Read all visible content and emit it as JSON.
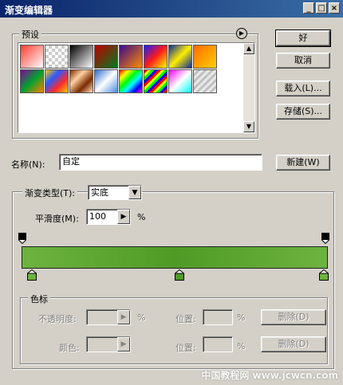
{
  "window": {
    "title": "渐变编辑器"
  },
  "titlebar_buttons": {
    "minimize": "_",
    "maximize": "□",
    "close": "×"
  },
  "presets": {
    "label": "预设",
    "menu_icon": "circle-arrow-icon"
  },
  "buttons": {
    "ok": "好",
    "cancel": "取消",
    "load": "载入(L)...",
    "save": "存储(S)...",
    "new": "新建(W)"
  },
  "name": {
    "label": "名称(N):",
    "value": "自定"
  },
  "gradient": {
    "type_label": "渐变类型(T):",
    "type_value": "实底",
    "smoothness_label": "平滑度(M):",
    "smoothness_value": "100",
    "smoothness_unit": "%",
    "colors": {
      "start": "#6db33f",
      "mid": "#4f9a26",
      "end": "#6db33f"
    }
  },
  "stops": {
    "group_label": "色标",
    "opacity_label": "不透明度:",
    "opacity_unit": "%",
    "opacity_location_label": "位置:",
    "opacity_location_unit": "%",
    "opacity_delete": "删除(D)",
    "color_label": "颜色:",
    "color_location_label": "位置:",
    "color_location_unit": "%",
    "color_delete": "删除(D)"
  },
  "watermark": "中国教程网 www.jcwcn.com"
}
